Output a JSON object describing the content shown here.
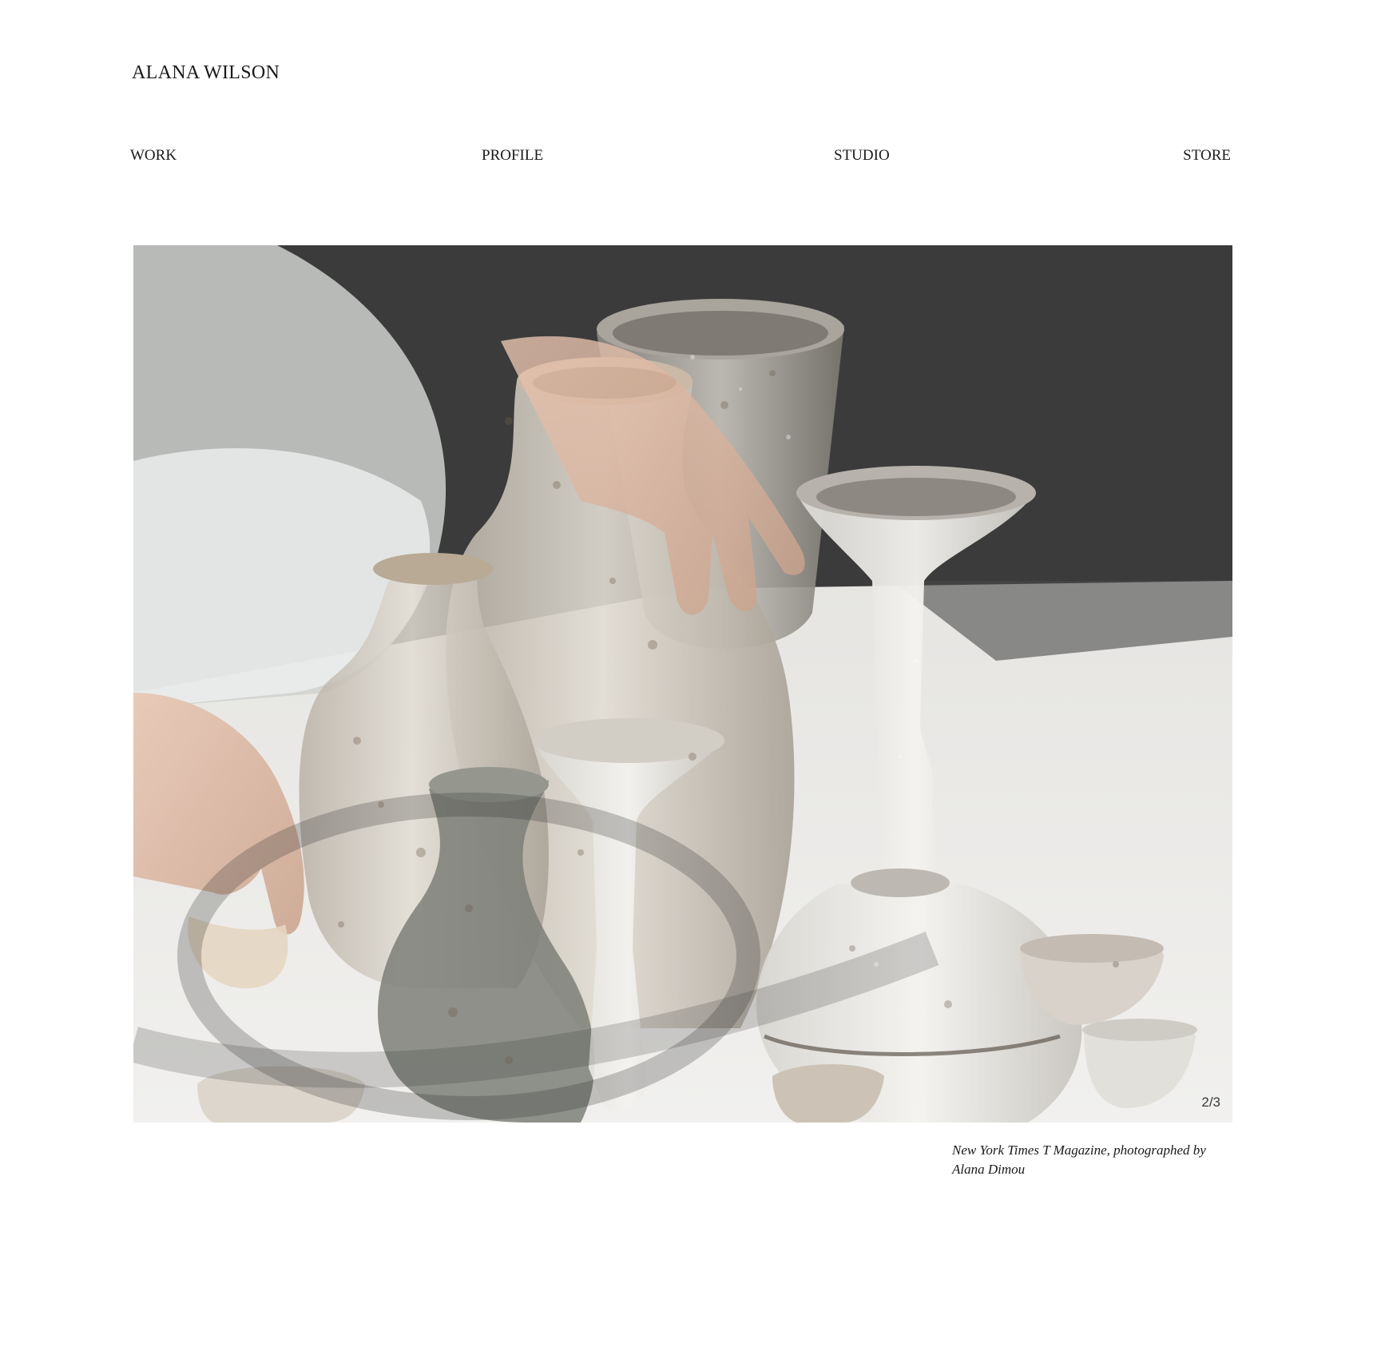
{
  "site": {
    "title": "ALANA WILSON"
  },
  "nav": {
    "items": [
      {
        "label": "WORK"
      },
      {
        "label": "PROFILE"
      },
      {
        "label": "STUDIO"
      },
      {
        "label": "STORE"
      }
    ]
  },
  "slideshow": {
    "counter": "2/3",
    "current": 2,
    "total": 3,
    "caption": "New York Times T Magazine, photographed by Alana Dimou",
    "image_subject": "ceramic-vessels-photo"
  }
}
